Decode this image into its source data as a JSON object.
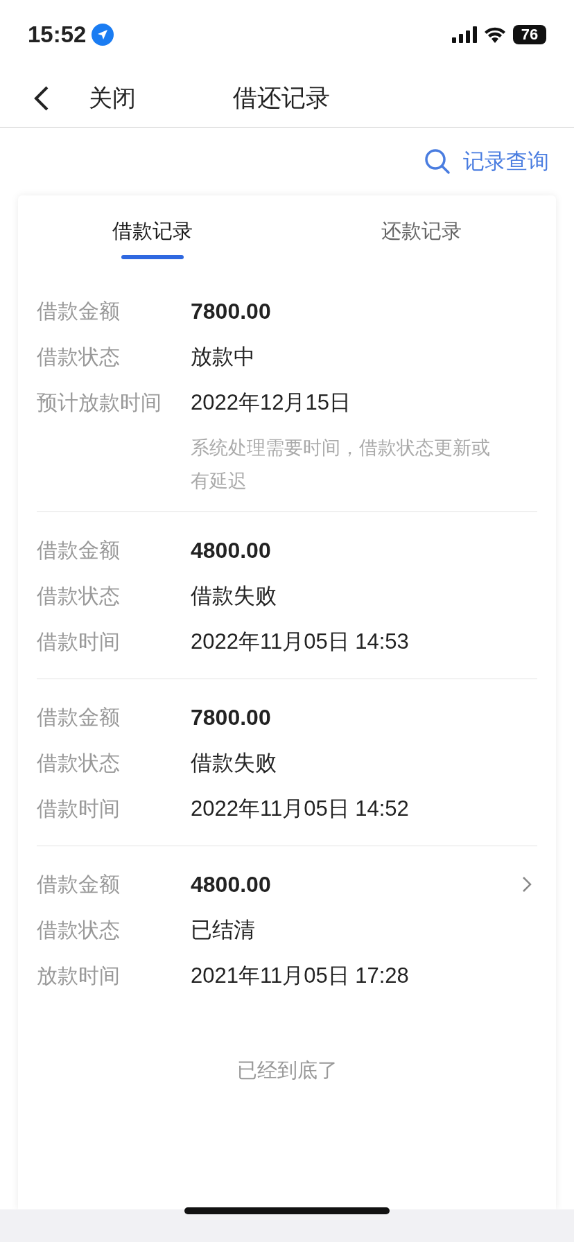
{
  "status_bar": {
    "time": "15:52",
    "battery": "76"
  },
  "nav": {
    "close": "关闭",
    "title": "借还记录"
  },
  "query": "记录查询",
  "tabs": [
    {
      "label": "借款记录",
      "selected": true
    },
    {
      "label": "还款记录",
      "selected": false
    }
  ],
  "records": [
    {
      "fields": [
        {
          "label": "借款金额",
          "value": "7800.00",
          "kind": "amount"
        },
        {
          "label": "借款状态",
          "value": "放款中",
          "kind": "text"
        },
        {
          "label": "预计放款时间",
          "value": "2022年12月15日",
          "kind": "text"
        }
      ],
      "note": "系统处理需要时间，借款状态更新或有延迟",
      "has_arrow": false
    },
    {
      "fields": [
        {
          "label": "借款金额",
          "value": "4800.00",
          "kind": "amount"
        },
        {
          "label": "借款状态",
          "value": "借款失败",
          "kind": "text"
        },
        {
          "label": "借款时间",
          "value": "2022年11月05日 14:53",
          "kind": "text"
        }
      ],
      "has_arrow": false
    },
    {
      "fields": [
        {
          "label": "借款金额",
          "value": "7800.00",
          "kind": "amount"
        },
        {
          "label": "借款状态",
          "value": "借款失败",
          "kind": "text"
        },
        {
          "label": "借款时间",
          "value": "2022年11月05日 14:52",
          "kind": "text"
        }
      ],
      "has_arrow": false
    },
    {
      "fields": [
        {
          "label": "借款金额",
          "value": "4800.00",
          "kind": "amount"
        },
        {
          "label": "借款状态",
          "value": "已结清",
          "kind": "text"
        },
        {
          "label": "放款时间",
          "value": "2021年11月05日 17:28",
          "kind": "text"
        }
      ],
      "has_arrow": true
    }
  ],
  "footer": "已经到底了"
}
